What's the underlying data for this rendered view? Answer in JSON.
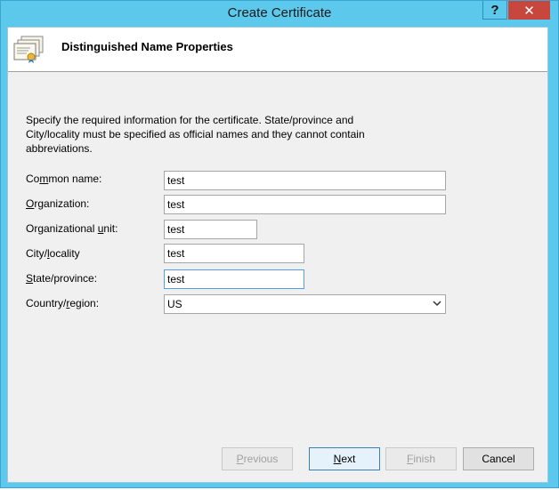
{
  "window": {
    "title": "Create Certificate",
    "help_glyph": "?",
    "close_glyph": "✕"
  },
  "header": {
    "title": "Distinguished Name Properties",
    "icon": "certificate-stack-icon"
  },
  "description": "Specify the required information for the certificate. State/province and City/locality must be specified as official names and they cannot contain abbreviations.",
  "fields": {
    "common_name": {
      "label_pre": "Co",
      "label_key": "m",
      "label_post": "mon name:",
      "value": "test"
    },
    "organization": {
      "label_pre": "",
      "label_key": "O",
      "label_post": "rganization:",
      "value": "test"
    },
    "org_unit": {
      "label_pre": "Organizational ",
      "label_key": "u",
      "label_post": "nit:",
      "value": "test"
    },
    "city": {
      "label_pre": "City/",
      "label_key": "l",
      "label_post": "ocality",
      "value": "test"
    },
    "state": {
      "label_pre": "",
      "label_key": "S",
      "label_post": "tate/province:",
      "value": "test"
    },
    "country": {
      "label_pre": "Country/",
      "label_key": "r",
      "label_post": "egion:",
      "value": "US"
    }
  },
  "buttons": {
    "previous": {
      "label_pre": "",
      "label_key": "P",
      "label_post": "revious"
    },
    "next": {
      "label_pre": "",
      "label_key": "N",
      "label_post": "ext"
    },
    "finish": {
      "label_pre": "",
      "label_key": "F",
      "label_post": "inish"
    },
    "cancel": {
      "label": "Cancel"
    }
  }
}
